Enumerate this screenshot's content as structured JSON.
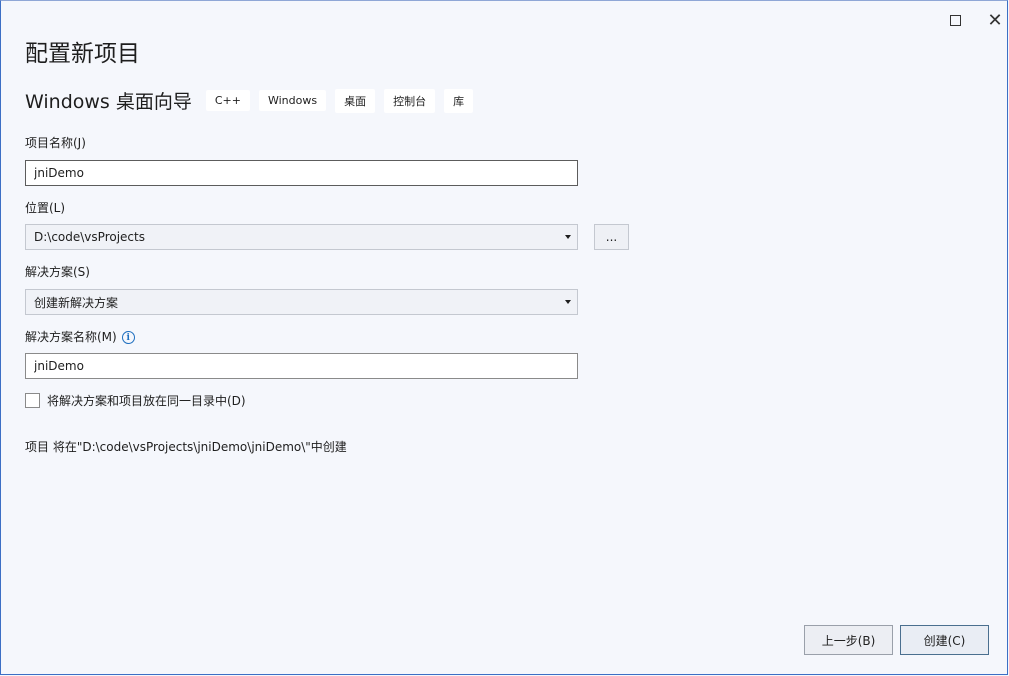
{
  "window": {
    "title": "配置新项目",
    "maximize_icon": "maximize-icon",
    "close_glyph": "✕"
  },
  "template": {
    "name": "Windows 桌面向导",
    "tags": [
      "C++",
      "Windows",
      "桌面",
      "控制台",
      "库"
    ]
  },
  "fields": {
    "project_name_label": "项目名称(J)",
    "project_name_value": "jniDemo",
    "location_label": "位置(L)",
    "location_value": "D:\\code\\vsProjects",
    "browse_label": "...",
    "solution_label": "解决方案(S)",
    "solution_value": "创建新解决方案",
    "solution_name_label": "解决方案名称(M)",
    "solution_name_value": "jniDemo",
    "info_glyph": "i",
    "same_dir_label": "将解决方案和项目放在同一目录中(D)",
    "same_dir_checked": false
  },
  "info_text": "项目 将在\"D:\\code\\vsProjects\\jniDemo\\jniDemo\\\"中创建",
  "buttons": {
    "back": "上一步(B)",
    "create": "创建(C)"
  },
  "colors": {
    "background": "#f5f7fc",
    "border_accent": "#3c6fc5",
    "info_icon": "#1f6fbf"
  }
}
